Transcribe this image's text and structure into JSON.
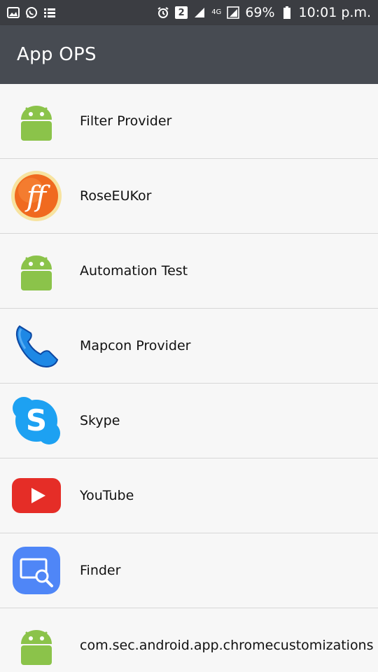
{
  "statusbar": {
    "left_icons": [
      "image-icon",
      "whatsapp-icon",
      "list-icon"
    ],
    "sim_badge": "2",
    "network_type": "4G",
    "battery": "69%",
    "time": "10:01 p.m."
  },
  "toolbar": {
    "title": "App OPS"
  },
  "apps": [
    {
      "label": "Filter Provider",
      "icon": "android-icon"
    },
    {
      "label": "RoseEUKor",
      "icon": "ff-logo-icon"
    },
    {
      "label": "Automation Test",
      "icon": "android-icon"
    },
    {
      "label": "Mapcon Provider",
      "icon": "phone-icon"
    },
    {
      "label": "Skype",
      "icon": "skype-icon"
    },
    {
      "label": "YouTube",
      "icon": "youtube-icon"
    },
    {
      "label": "Finder",
      "icon": "finder-icon"
    },
    {
      "label": "com.sec.android.app.chromecustomizations",
      "icon": "android-icon"
    }
  ],
  "colors": {
    "statusbar": "#3b3d42",
    "toolbar": "#474b52",
    "background": "#f7f7f7",
    "android_green": "#8bc34a",
    "youtube_red": "#e52d27",
    "skype_blue": "#1da1f2",
    "finder_blue": "#4f86f7"
  }
}
